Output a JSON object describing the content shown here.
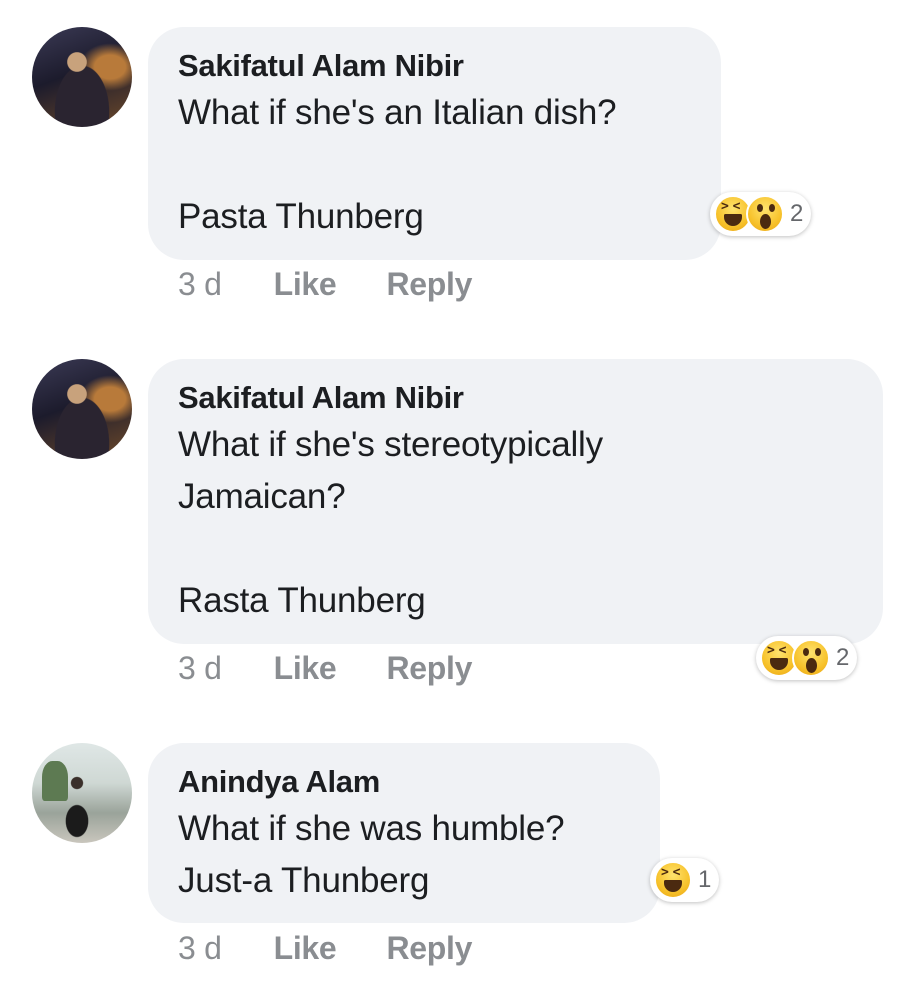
{
  "comments": [
    {
      "author": "Sakifatul Alam Nibir",
      "text": "What if she's an Italian dish?\n\nPasta Thunberg",
      "time": "3 d",
      "like_label": "Like",
      "reply_label": "Reply",
      "reactions": [
        "haha",
        "wow"
      ],
      "reaction_count": "2"
    },
    {
      "author": "Sakifatul Alam Nibir",
      "text": "What if she's stereotypically\nJamaican?\n\nRasta Thunberg",
      "time": "3 d",
      "like_label": "Like",
      "reply_label": "Reply",
      "reactions": [
        "haha",
        "wow"
      ],
      "reaction_count": "2"
    },
    {
      "author": "Anindya Alam",
      "text": "What if she was humble?\nJust-a Thunberg",
      "time": "3 d",
      "like_label": "Like",
      "reply_label": "Reply",
      "reactions": [
        "haha"
      ],
      "reaction_count": "1"
    }
  ],
  "colors": {
    "bubble": "#f0f2f5",
    "action_text": "#8a8d91",
    "body_text": "#1c1e21"
  }
}
